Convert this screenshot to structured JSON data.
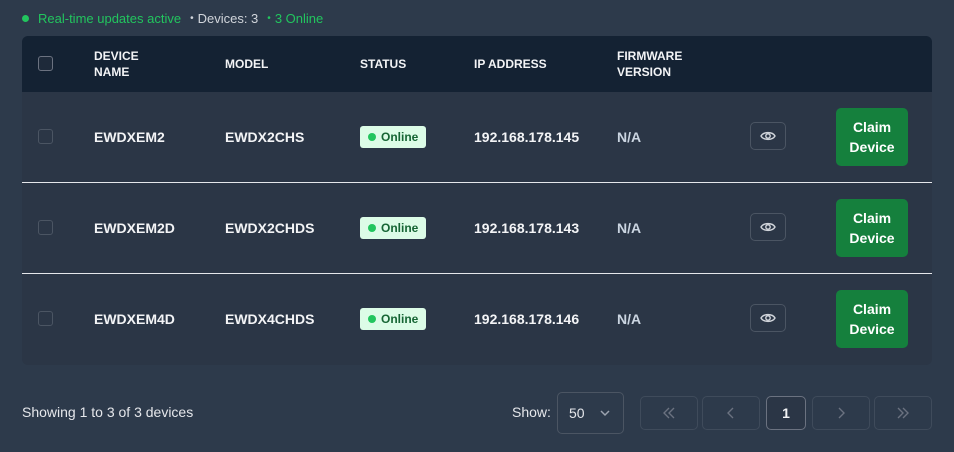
{
  "status_bar": {
    "live_text": "Real-time updates active",
    "devices_text": "Devices: 3",
    "online_text": "3 Online"
  },
  "table": {
    "headers": {
      "device_name": "DEVICE NAME",
      "model": "MODEL",
      "status": "STATUS",
      "ip_address": "IP ADDRESS",
      "firmware": "FIRMWARE VERSION"
    },
    "rows": [
      {
        "name": "EWDXEM2",
        "model": "EWDX2CHS",
        "status": "Online",
        "ip": "192.168.178.145",
        "firmware": "N/A",
        "claim_label": "Claim Device"
      },
      {
        "name": "EWDXEM2D",
        "model": "EWDX2CHDS",
        "status": "Online",
        "ip": "192.168.178.143",
        "firmware": "N/A",
        "claim_label": "Claim Device"
      },
      {
        "name": "EWDXEM4D",
        "model": "EWDX4CHDS",
        "status": "Online",
        "ip": "192.168.178.146",
        "firmware": "N/A",
        "claim_label": "Claim Device"
      }
    ]
  },
  "footer": {
    "summary": "Showing 1 to 3 of 3 devices",
    "show_label": "Show:",
    "page_size": "50",
    "current_page": "1"
  },
  "colors": {
    "background": "#2d3a4b",
    "header_bg": "#142233",
    "accent_green": "#22c55e",
    "claim_button": "#15803d",
    "badge_bg": "#dcfce7"
  },
  "icons": {
    "status_dot": "green-dot-icon",
    "view": "eye-icon",
    "select": "chevron-down-icon",
    "first": "double-chevron-left-icon",
    "prev": "chevron-left-icon",
    "next": "chevron-right-icon",
    "last": "double-chevron-right-icon"
  }
}
